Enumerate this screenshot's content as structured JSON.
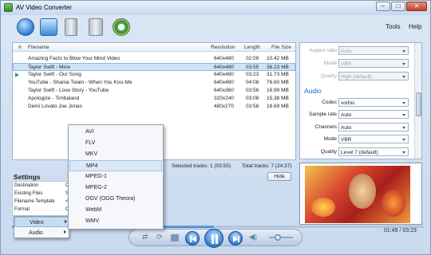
{
  "window": {
    "title": "AV Video Converter",
    "buttons": {
      "minimize": "–",
      "maximize": "□",
      "close": "✕"
    }
  },
  "menu": {
    "tools": "Tools",
    "help": "Help"
  },
  "list": {
    "headers": {
      "num": "#",
      "filename": "Filename",
      "resolution": "Resolution",
      "length": "Length",
      "size": "File Size"
    },
    "rows": [
      {
        "name": "Amazing Facts to Blow Your Mind Video",
        "res": "640x480",
        "len": "02:09",
        "size": "10.42 MB"
      },
      {
        "name": "Taylor Swift - Mine",
        "res": "640x480",
        "len": "03:55",
        "size": "36.23 MB"
      },
      {
        "name": "Taylor Swift - Our Song",
        "res": "640x480",
        "len": "03:23",
        "size": "31.73 MB"
      },
      {
        "name": "YouTube - Shania Twain - When You Kiss Me",
        "res": "640x480",
        "len": "04:08",
        "size": "76.60 MB"
      },
      {
        "name": "Taylor Swift - Love Story - YouTube",
        "res": "640x360",
        "len": "03:56",
        "size": "16.99 MB"
      },
      {
        "name": "Apologize - Timbaland",
        "res": "320x240",
        "len": "03:08",
        "size": "15.38 MB"
      },
      {
        "name": "Demi Lovato Joe Jonas",
        "res": "480x270",
        "len": "03:56",
        "size": "18.69 MB"
      }
    ]
  },
  "status": {
    "selected": "Selected tracks: 1 (03:55)",
    "total": "Total tracks: 7 (24:37)",
    "hide": "Hide"
  },
  "settings": {
    "title": "Settings",
    "rows": [
      {
        "label": "Destination",
        "value": "C"
      },
      {
        "label": "Existing Files",
        "value": "S"
      },
      {
        "label": "Filename Template",
        "value": "<"
      },
      {
        "label": "Format",
        "value": "C"
      }
    ]
  },
  "context_menu": {
    "items": [
      "Video",
      "Audio"
    ]
  },
  "format_menu": {
    "items": [
      "AVI",
      "FLV",
      "MKV",
      "MP4",
      "MPEG-1",
      "MPEG-2",
      "OGV (OGG Theora)",
      "WebM",
      "WMV"
    ],
    "highlighted": "MP4"
  },
  "props": {
    "video": [
      {
        "label": "Aspect ratio",
        "value": "Auto"
      },
      {
        "label": "Mode",
        "value": "VBR"
      },
      {
        "label": "Quality",
        "value": "High (default)"
      }
    ],
    "audio_header": "Audio",
    "audio": [
      {
        "label": "Codec",
        "value": "vorbis"
      },
      {
        "label": "Sample rate",
        "value": "Auto"
      },
      {
        "label": "Channels",
        "value": "Auto"
      },
      {
        "label": "Mode",
        "value": "VBR"
      },
      {
        "label": "Quality",
        "value": "Level 7 (default)"
      }
    ]
  },
  "player": {
    "time": "01:49 / 03:23",
    "progress": 0.49,
    "volume": 0.35
  },
  "colors": {
    "accent": "#3a7cc4",
    "selection": "#cfe3f9",
    "audio_header": "#1b63c6"
  }
}
